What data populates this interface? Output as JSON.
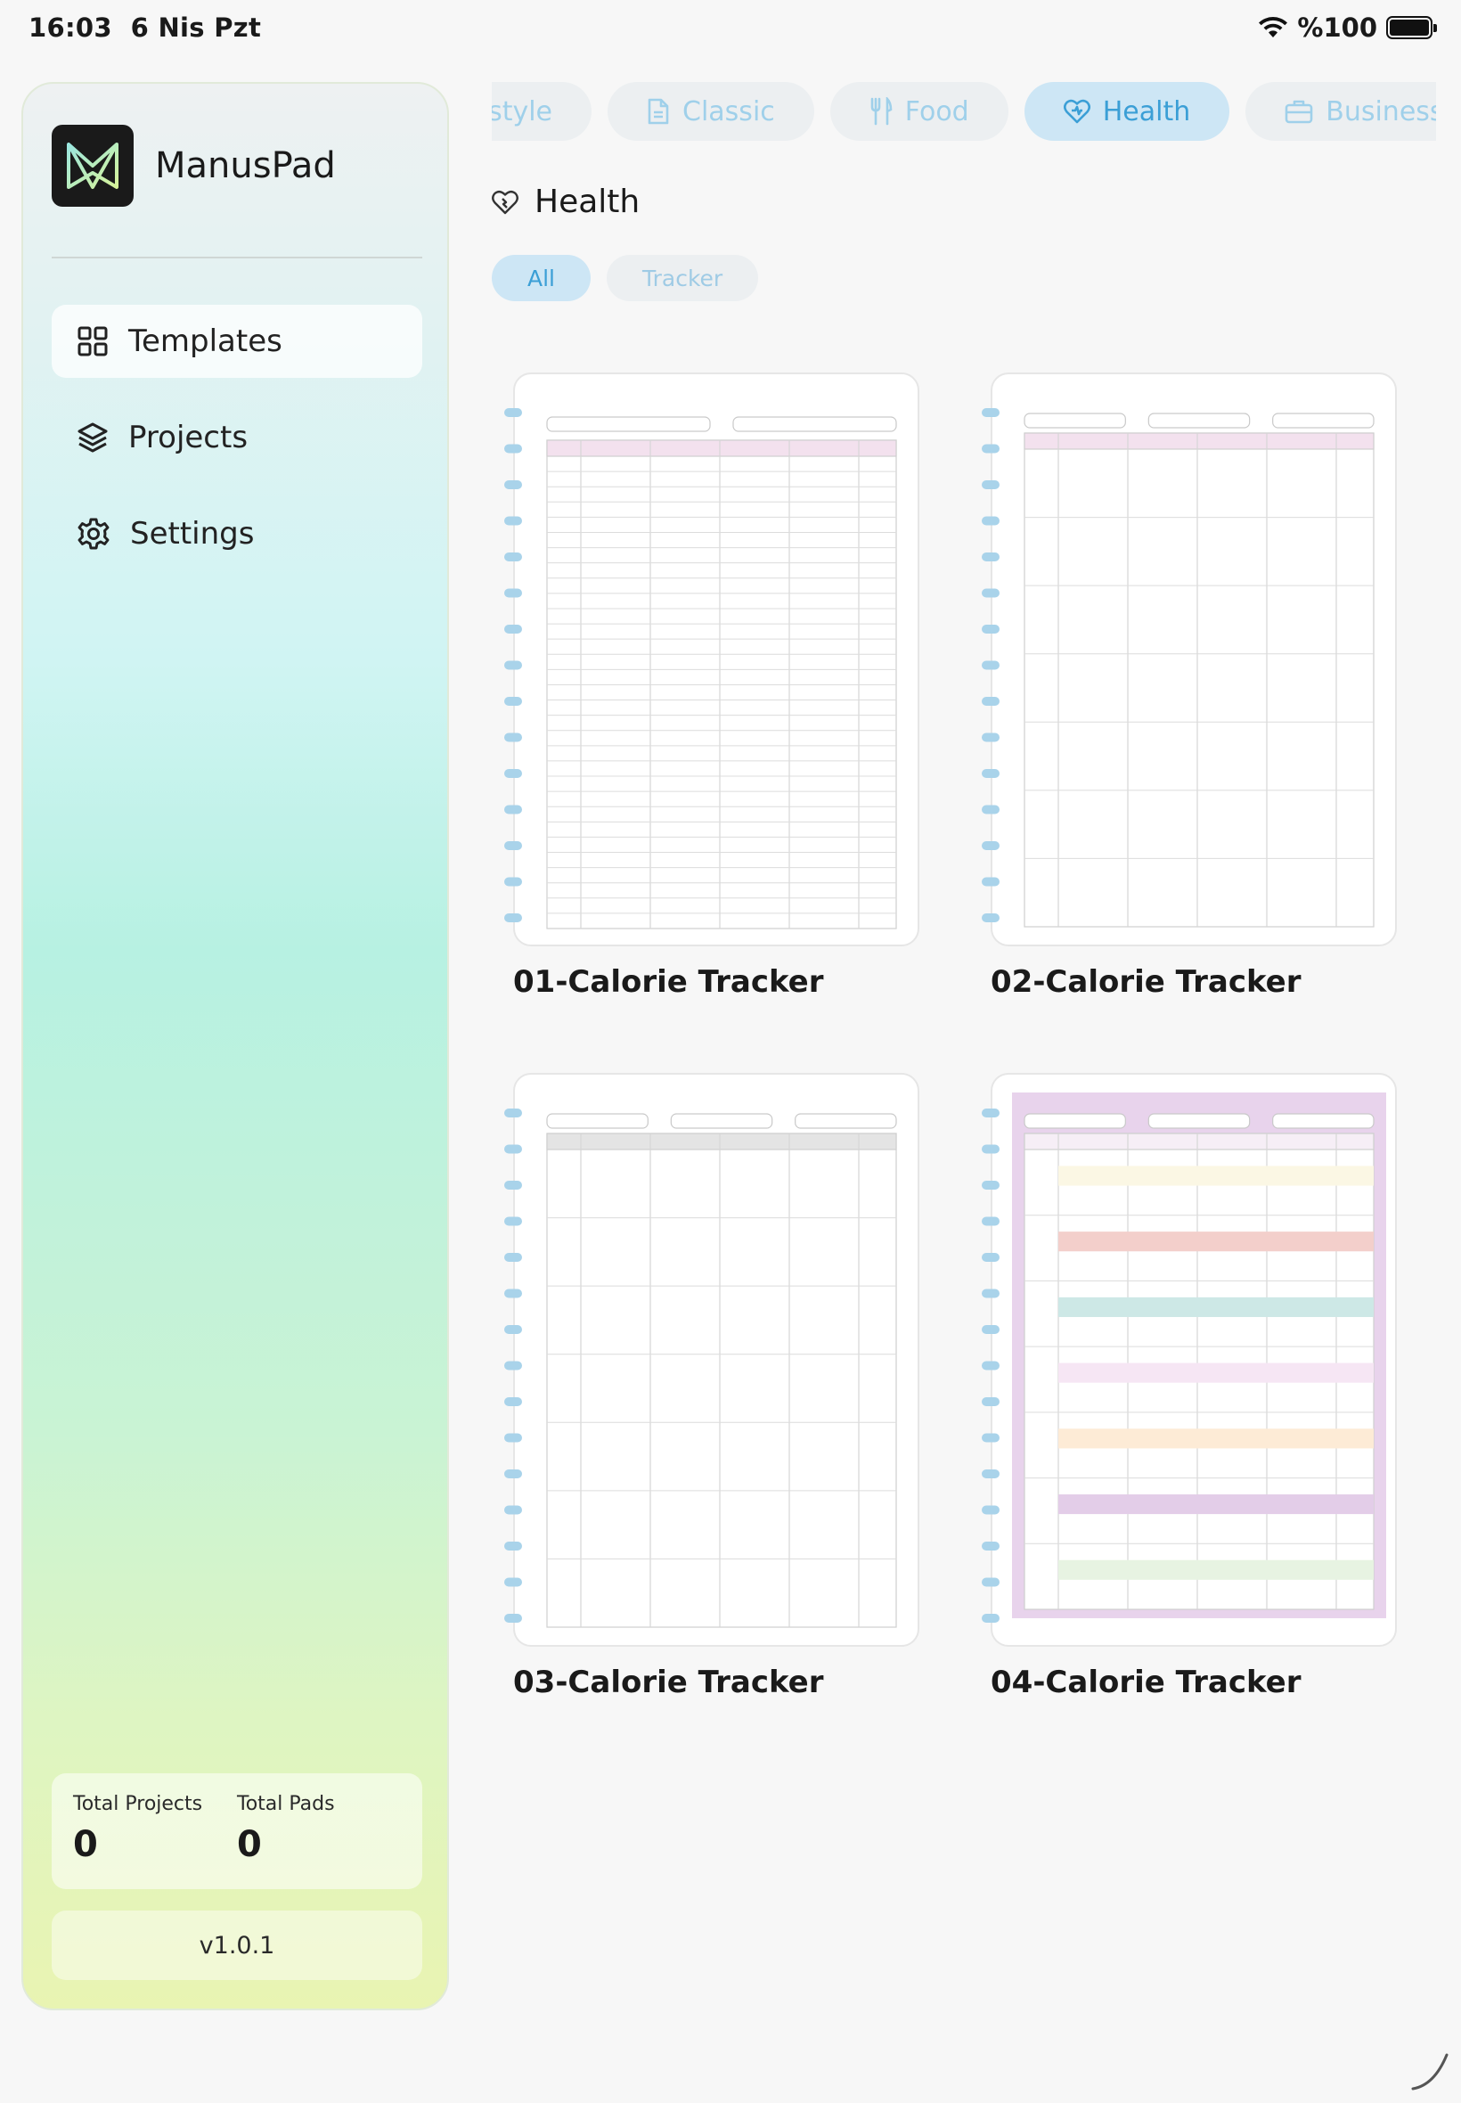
{
  "status": {
    "time": "16:03",
    "date": "6 Nis Pzt",
    "battery": "%100"
  },
  "app": {
    "name": "ManusPad",
    "version": "v1.0.1"
  },
  "nav": [
    {
      "label": "Templates",
      "icon": "grid-icon",
      "active": true
    },
    {
      "label": "Projects",
      "icon": "layers-icon",
      "active": false
    },
    {
      "label": "Settings",
      "icon": "gear-icon",
      "active": false
    }
  ],
  "stats": {
    "projects_label": "Total Projects",
    "projects_value": "0",
    "pads_label": "Total Pads",
    "pads_value": "0"
  },
  "categories": [
    {
      "label": "Lifestyle",
      "icon": "none"
    },
    {
      "label": "Classic",
      "icon": "document-icon"
    },
    {
      "label": "Food",
      "icon": "cutlery-icon"
    },
    {
      "label": "Health",
      "icon": "heart-pulse-icon",
      "active": true
    },
    {
      "label": "Business",
      "icon": "briefcase-icon"
    }
  ],
  "section": {
    "title": "Health"
  },
  "subfilters": [
    {
      "label": "All",
      "active": true
    },
    {
      "label": "Tracker",
      "active": false
    }
  ],
  "templates": [
    {
      "title": "01-Calorie Tracker"
    },
    {
      "title": "02-Calorie Tracker"
    },
    {
      "title": "03-Calorie Tracker"
    },
    {
      "title": "04-Calorie Tracker"
    }
  ],
  "colors": {
    "accent": "#3b9fd6",
    "accent_soft": "#cde6f5",
    "chip_inactive_text": "#9fd0ea"
  }
}
